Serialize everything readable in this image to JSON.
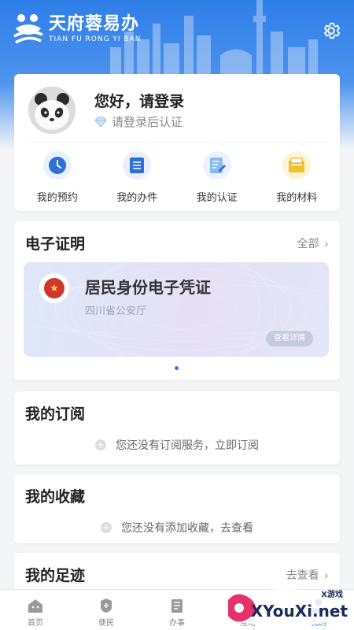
{
  "app": {
    "logo_cn": "天府蓉易办",
    "logo_en": "TIAN FU RONG YI BAN",
    "brand_color": "#2e7ee8"
  },
  "user": {
    "greeting": "您好，请登录",
    "verify_text": "请登录后认证"
  },
  "quick_actions": [
    {
      "label": "我的预约",
      "icon": "clock-icon",
      "color": "#2e6fd8"
    },
    {
      "label": "我的办件",
      "icon": "document-list-icon",
      "color": "#2e6fd8"
    },
    {
      "label": "我的认证",
      "icon": "certificate-edit-icon",
      "color": "#6aa2f0"
    },
    {
      "label": "我的材料",
      "icon": "folder-icon",
      "color": "#f3c12b"
    }
  ],
  "e_cert": {
    "title": "电子证明",
    "more": "全部",
    "card_title": "居民身份电子凭证",
    "card_issuer": "四川省公安厅",
    "card_button": "查看详情"
  },
  "subscription": {
    "title": "我的订阅",
    "empty": "您还没有订阅服务，立即订阅"
  },
  "favorites": {
    "title": "我的收藏",
    "empty": "您还没有添加收藏，去查看"
  },
  "trace": {
    "title": "我的足迹",
    "more": "去查看"
  },
  "tabs": [
    {
      "label": "首页",
      "icon": "home-icon"
    },
    {
      "label": "便民",
      "icon": "service-icon"
    },
    {
      "label": "办事",
      "icon": "affairs-icon"
    },
    {
      "label": "互动",
      "icon": "chat-icon"
    },
    {
      "label": "我的",
      "icon": "user-icon"
    }
  ],
  "watermark": {
    "text": "XYouXi.net",
    "small": "X游戏"
  }
}
